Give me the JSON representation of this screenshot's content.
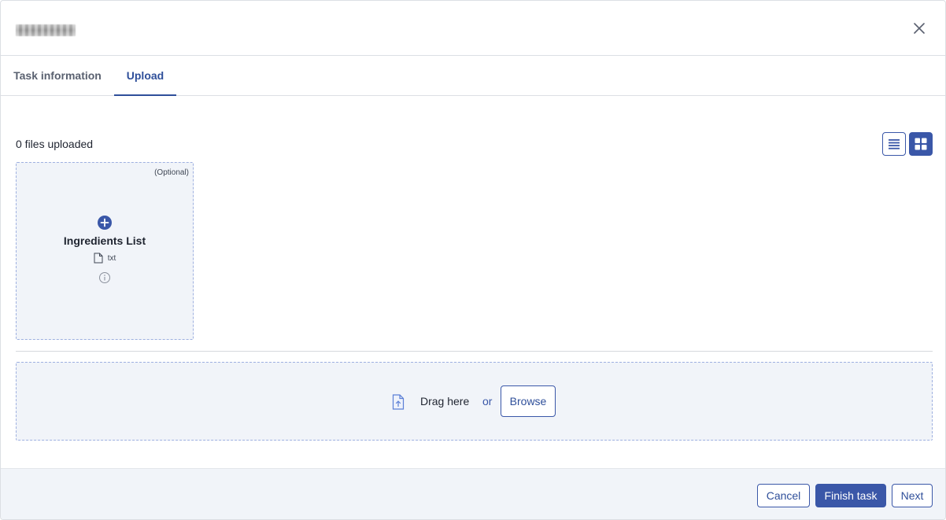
{
  "header": {
    "title_redacted": true,
    "close_icon": "close-icon"
  },
  "tabs": [
    {
      "label": "Task information",
      "active": false
    },
    {
      "label": "Upload",
      "active": true
    }
  ],
  "upload": {
    "files_uploaded_text": "0 files uploaded",
    "view_modes": [
      {
        "name": "list",
        "icon": "list-view-icon",
        "active": false
      },
      {
        "name": "grid",
        "icon": "grid-view-icon",
        "active": true
      }
    ],
    "slots": [
      {
        "optional_label": "(Optional)",
        "name": "Ingredients List",
        "file_type": "txt",
        "icons": [
          "add-circle-icon",
          "file-icon",
          "info-icon"
        ]
      }
    ],
    "dropzone": {
      "drag_text": "Drag here",
      "or_text": "or",
      "browse_label": "Browse",
      "icon": "file-upload-icon"
    }
  },
  "footer": {
    "cancel_label": "Cancel",
    "finish_label": "Finish task",
    "next_label": "Next"
  },
  "colors": {
    "accent": "#3a57a8",
    "tab_active": "#2f4f9a",
    "panel_bg": "#f1f4f9",
    "dashed_border": "#9eb0e0"
  }
}
